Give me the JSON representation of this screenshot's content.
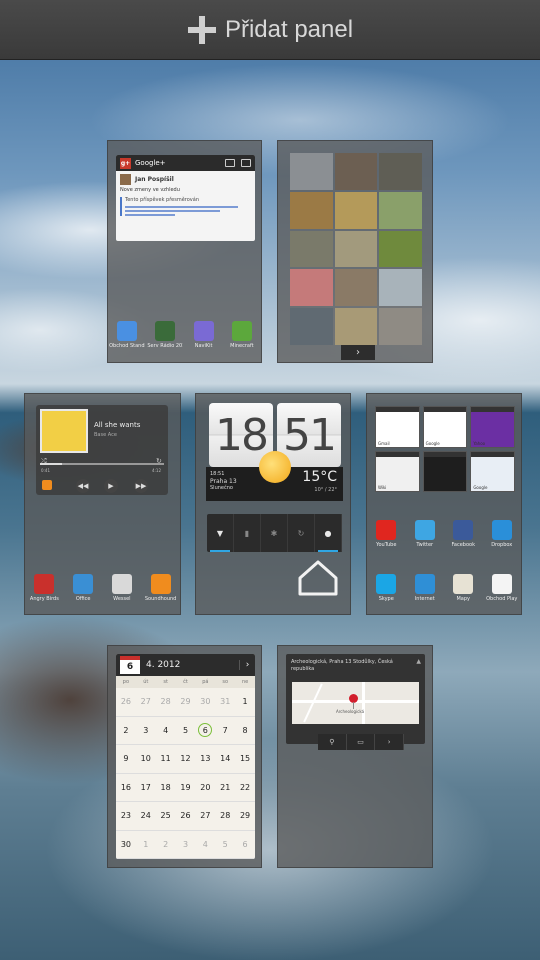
{
  "header": {
    "add_panel_label": "Přidat panel"
  },
  "panel1": {
    "gplus": {
      "title": "Google+",
      "author": "Jan Pospíšil",
      "post_text": "Nove zmeny ve vzhledu",
      "quote_text": "Tento příspěvek přesměrován"
    },
    "apps": [
      {
        "label": "Obchod Standby",
        "color": "#4a90e2"
      },
      {
        "label": "Serv Rádio 2012",
        "color": "#3a6b3a"
      },
      {
        "label": "NaviKit",
        "color": "#7a6ad4"
      },
      {
        "label": "Minecraft",
        "color": "#5ca83c"
      }
    ]
  },
  "panel2": {
    "gallery_colors": [
      "#8b8f93",
      "#6c5f52",
      "#5f5e55",
      "#9b7a45",
      "#b49a5a",
      "#8aa06a",
      "#7a7a6a",
      "#a29a7d",
      "#6f8a3d",
      "#c57a7a",
      "#8a7a66",
      "#a8b3ba",
      "#606a72",
      "#a89a76",
      "#8f8b84"
    ]
  },
  "panel3": {
    "song_title": "All she wants",
    "song_artist": "Base Ace",
    "time_elapsed": "0:41",
    "time_total": "4:12",
    "progress": 0.18,
    "apps": [
      {
        "label": "Angry Birds",
        "color": "#c9302c"
      },
      {
        "label": "Office",
        "color": "#3a8fd4"
      },
      {
        "label": "Wessel",
        "color": "#d9d9d9"
      },
      {
        "label": "Soundhound",
        "color": "#f08c1e"
      }
    ]
  },
  "panel4": {
    "hours": "18",
    "minutes": "51",
    "date_label": "18:51",
    "city": "Praha 13",
    "weather_desc": "Slunečno",
    "temperature": "15°C",
    "temp_range": "10° / 22°"
  },
  "panel5": {
    "tabs": [
      {
        "label": "Gmail",
        "color": "#ffffff"
      },
      {
        "label": "Google",
        "color": "#ffffff"
      },
      {
        "label": "Yahoo",
        "color": "#6b2fa3"
      },
      {
        "label": "Wiki",
        "color": "#f0f0f0"
      },
      {
        "label": "",
        "color": "#1e1e1e"
      },
      {
        "label": "Google",
        "color": "#e8eef5"
      }
    ],
    "apps_row1": [
      {
        "label": "YouTube",
        "color": "#e0261f"
      },
      {
        "label": "Twitter",
        "color": "#3ea6e3"
      },
      {
        "label": "Facebook",
        "color": "#3b5a9a"
      },
      {
        "label": "Dropbox",
        "color": "#2a8fd9"
      }
    ],
    "apps_row2": [
      {
        "label": "Skype",
        "color": "#1ba6e5"
      },
      {
        "label": "Internet",
        "color": "#2f8fd6"
      },
      {
        "label": "Mapy",
        "color": "#e7e2d4"
      },
      {
        "label": "Obchod Play",
        "color": "#f4f4f4"
      }
    ]
  },
  "panel6": {
    "badge_day": "6",
    "month_label": "4. 2012",
    "weekday_headers": [
      "po",
      "út",
      "st",
      "čt",
      "pá",
      "so",
      "ne"
    ],
    "days": [
      {
        "d": "26",
        "muted": true
      },
      {
        "d": "27",
        "muted": true
      },
      {
        "d": "28",
        "muted": true
      },
      {
        "d": "29",
        "muted": true
      },
      {
        "d": "30",
        "muted": true
      },
      {
        "d": "31",
        "muted": true
      },
      {
        "d": "1",
        "muted": false
      },
      {
        "d": "2",
        "muted": false
      },
      {
        "d": "3",
        "muted": false
      },
      {
        "d": "4",
        "muted": false
      },
      {
        "d": "5",
        "muted": false
      },
      {
        "d": "6",
        "muted": false,
        "today": true
      },
      {
        "d": "7",
        "muted": false
      },
      {
        "d": "8",
        "muted": false
      },
      {
        "d": "9",
        "muted": false
      },
      {
        "d": "10",
        "muted": false
      },
      {
        "d": "11",
        "muted": false
      },
      {
        "d": "12",
        "muted": false
      },
      {
        "d": "13",
        "muted": false
      },
      {
        "d": "14",
        "muted": false
      },
      {
        "d": "15",
        "muted": false
      },
      {
        "d": "16",
        "muted": false
      },
      {
        "d": "17",
        "muted": false
      },
      {
        "d": "18",
        "muted": false
      },
      {
        "d": "19",
        "muted": false
      },
      {
        "d": "20",
        "muted": false
      },
      {
        "d": "21",
        "muted": false
      },
      {
        "d": "22",
        "muted": false
      },
      {
        "d": "23",
        "muted": false
      },
      {
        "d": "24",
        "muted": false
      },
      {
        "d": "25",
        "muted": false
      },
      {
        "d": "26",
        "muted": false
      },
      {
        "d": "27",
        "muted": false
      },
      {
        "d": "28",
        "muted": false
      },
      {
        "d": "29",
        "muted": false
      },
      {
        "d": "30",
        "muted": false
      },
      {
        "d": "1",
        "muted": true
      },
      {
        "d": "2",
        "muted": true
      },
      {
        "d": "3",
        "muted": true
      },
      {
        "d": "4",
        "muted": true
      },
      {
        "d": "5",
        "muted": true
      },
      {
        "d": "6",
        "muted": true
      }
    ]
  },
  "panel7": {
    "address": "Archeologická, Praha 13 Stodůlky, Česká republika",
    "map_label": "Archeologická"
  },
  "colors": {
    "accent": "#2fa6e3",
    "panel_bg": "#5a5a5a",
    "header_bg": "#3a3a3a"
  }
}
